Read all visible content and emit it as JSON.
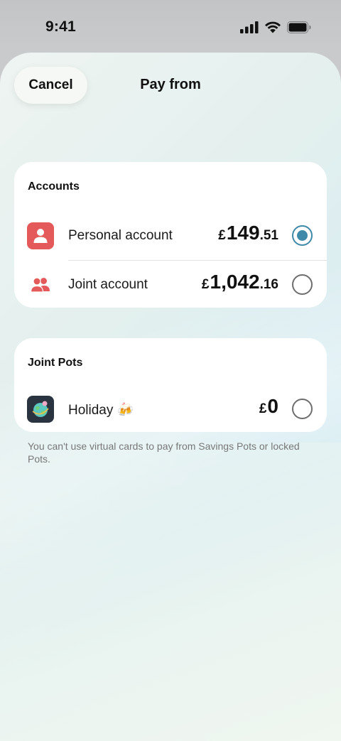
{
  "status_bar": {
    "time": "9:41"
  },
  "header": {
    "cancel_label": "Cancel",
    "title": "Pay from"
  },
  "accounts": {
    "header": "Accounts",
    "items": [
      {
        "label": "Personal account",
        "currency": "£",
        "amount_main": "149",
        "amount_dec": ".51",
        "selected": true,
        "icon": "person-icon",
        "icon_color": "#e45a5a"
      },
      {
        "label": "Joint account",
        "currency": "£",
        "amount_main": "1,042",
        "amount_dec": ".16",
        "selected": false,
        "icon": "people-icon",
        "icon_color": "#e45a5a"
      }
    ]
  },
  "pots": {
    "header": "Joint Pots",
    "items": [
      {
        "label": "Holiday 🍻",
        "currency": "£",
        "amount_main": "0",
        "amount_dec": "",
        "selected": false,
        "icon": "globe-icon"
      }
    ]
  },
  "footnote": "You can't use virtual cards to pay from Savings Pots or locked Pots.",
  "colors": {
    "accent": "#3f8aa8",
    "account_icon": "#e45a5a"
  }
}
